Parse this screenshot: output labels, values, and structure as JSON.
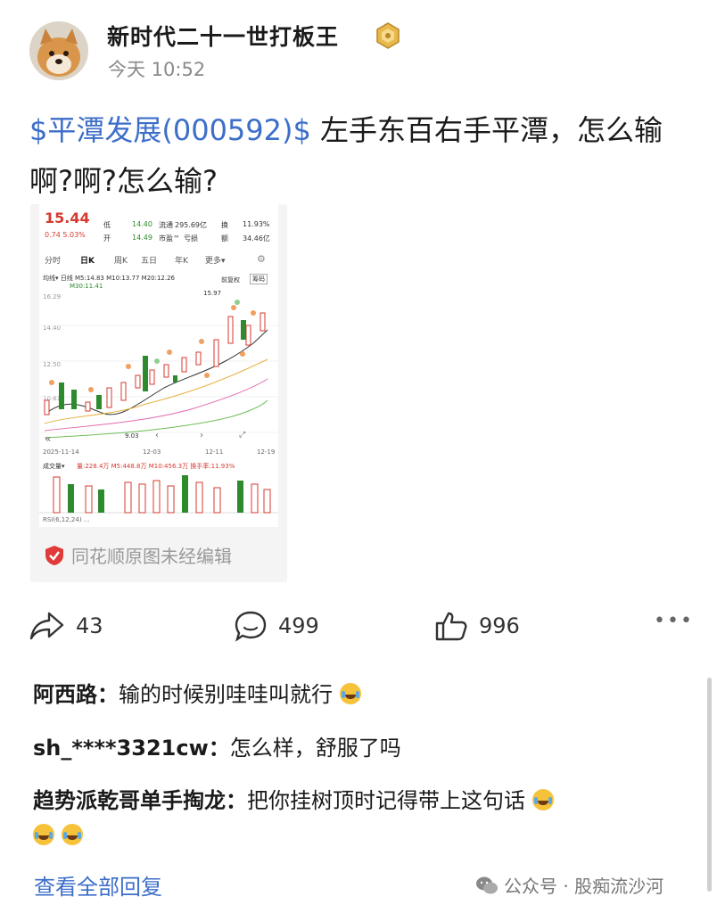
{
  "post": {
    "author": "新时代二十一世打板王",
    "time": "今天 10:52",
    "stock_tag": "$平潭发展(000592)$",
    "text": " 左手东百右手平潭，怎么输啊?啊?怎么输?",
    "shares": "43",
    "comments": "499",
    "likes": "996",
    "more": "•••"
  },
  "screenshot": {
    "price": "15.44",
    "change": "0.74 5.03%",
    "low_label": "低",
    "low_value": "14.40",
    "open_label": "开",
    "open_value": "14.49",
    "float_label": "流通",
    "float_value": "295.69亿",
    "pe_label": "市盈™",
    "pe_value": "亏损",
    "turnover_label": "换",
    "turnover_value": "11.93%",
    "amount_label": "额",
    "amount_value": "34.46亿",
    "tabs": [
      "分时",
      "日K",
      "周K",
      "五日",
      "年K",
      "更多▾"
    ],
    "ma_line": "均线▾  日线  M5:14.83  M10:13.77  M20:12.26",
    "ma30": "M30:11.41",
    "adjust": "前复权",
    "chips": "筹码",
    "y_ticks": [
      "16.29",
      "14.40",
      "12.50",
      "10.61"
    ],
    "high_mark": "15.97",
    "low_mark": "9.03",
    "dates": [
      "2025-11-14",
      "12-03",
      "12-11",
      "12-19"
    ],
    "vol_label": "成交量▾",
    "vol_line": "量:228.4万  M5:448.8万  M10:456.3万  换手率:11.93%",
    "rsi_line": "RSI(6,12,24)  ...",
    "watermark": "同花顺原图未经编辑"
  },
  "comments": [
    {
      "name": "阿西路：",
      "text": "输的时候别哇哇叫就行"
    },
    {
      "name": "sh_****3321cw：",
      "text": "怎么样，舒服了吗"
    },
    {
      "name": "趋势派乾哥单手掏龙：",
      "text": "把你挂树顶时记得带上这句话"
    }
  ],
  "view_all": "查看全部回复",
  "source": "公众号 · 股痴流沙河",
  "colors": {
    "link": "#3d6ec9",
    "up": "#d63a2f",
    "down": "#2d8a2d"
  }
}
